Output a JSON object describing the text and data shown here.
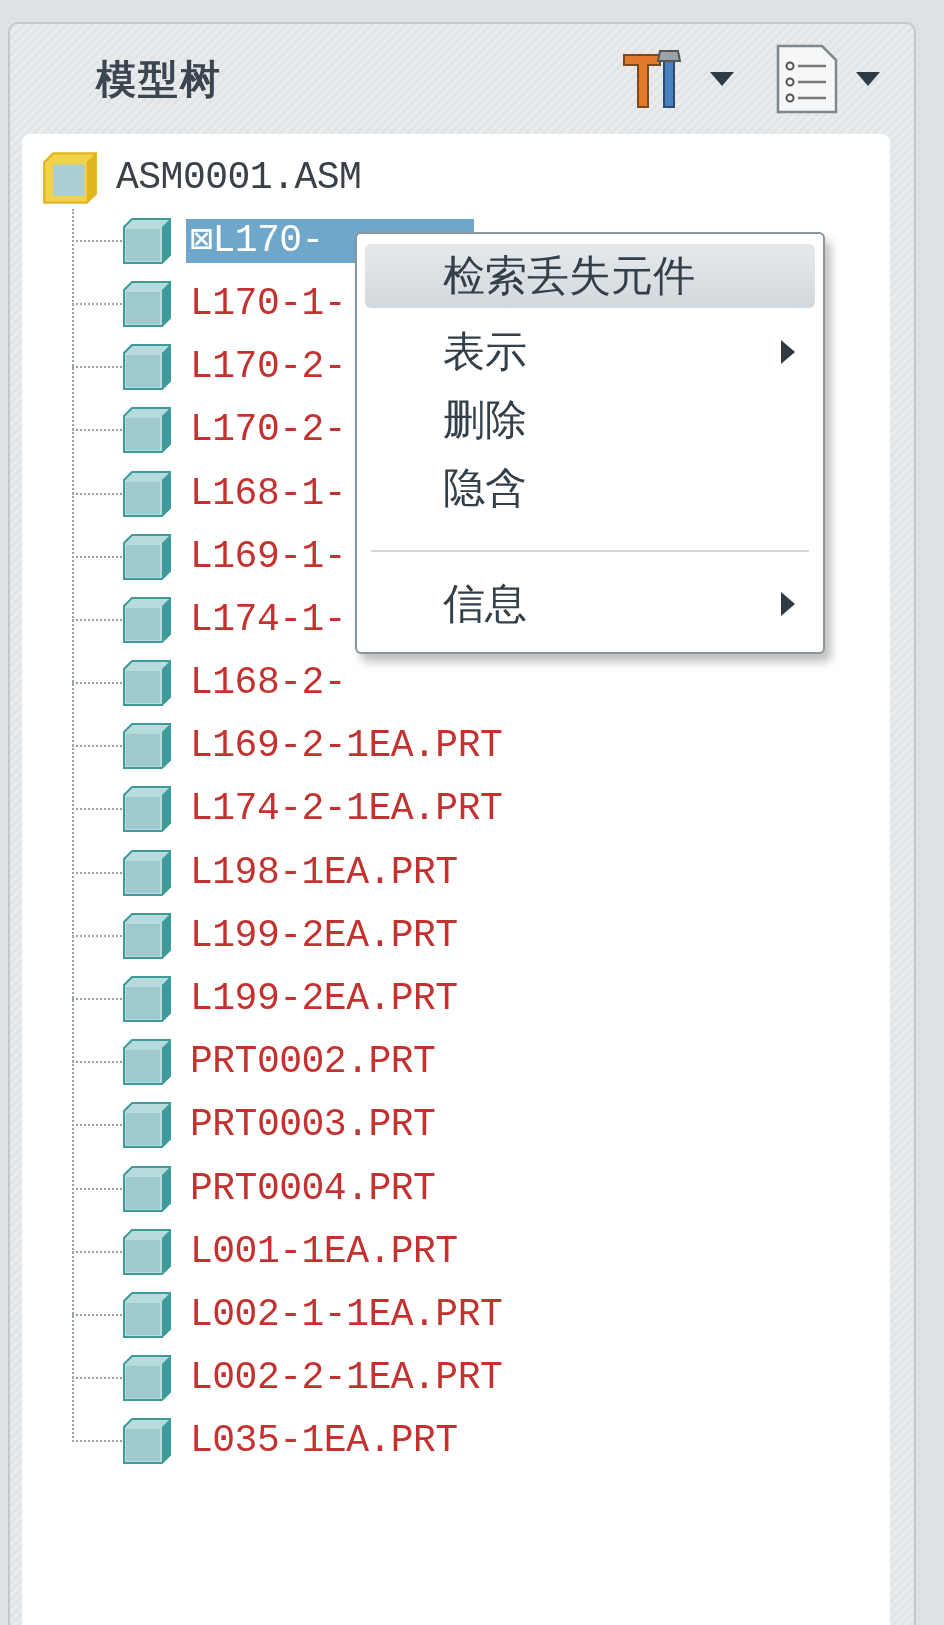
{
  "panel": {
    "title": "模型树"
  },
  "tree": {
    "label": "ASM0001.ASM",
    "kind": "assembly",
    "missing": false,
    "selected": false,
    "children": [
      {
        "label": "⊠L170-",
        "kind": "part",
        "missing": true,
        "selected": true
      },
      {
        "label": "L170-1-",
        "kind": "part",
        "missing": true,
        "selected": false
      },
      {
        "label": "L170-2-",
        "kind": "part",
        "missing": true,
        "selected": false
      },
      {
        "label": "L170-2-",
        "kind": "part",
        "missing": true,
        "selected": false
      },
      {
        "label": "L168-1-",
        "kind": "part",
        "missing": true,
        "selected": false
      },
      {
        "label": "L169-1-",
        "kind": "part",
        "missing": true,
        "selected": false
      },
      {
        "label": "L174-1-",
        "kind": "part",
        "missing": true,
        "selected": false
      },
      {
        "label": "L168-2-",
        "kind": "part",
        "missing": true,
        "selected": false
      },
      {
        "label": "L169-2-1EA.PRT",
        "kind": "part",
        "missing": true,
        "selected": false
      },
      {
        "label": "L174-2-1EA.PRT",
        "kind": "part",
        "missing": true,
        "selected": false
      },
      {
        "label": "L198-1EA.PRT",
        "kind": "part",
        "missing": true,
        "selected": false
      },
      {
        "label": "L199-2EA.PRT",
        "kind": "part",
        "missing": true,
        "selected": false
      },
      {
        "label": "L199-2EA.PRT",
        "kind": "part",
        "missing": true,
        "selected": false
      },
      {
        "label": "PRT0002.PRT",
        "kind": "part",
        "missing": true,
        "selected": false
      },
      {
        "label": "PRT0003.PRT",
        "kind": "part",
        "missing": true,
        "selected": false
      },
      {
        "label": "PRT0004.PRT",
        "kind": "part",
        "missing": true,
        "selected": false
      },
      {
        "label": "L001-1EA.PRT",
        "kind": "part",
        "missing": true,
        "selected": false
      },
      {
        "label": "L002-1-1EA.PRT",
        "kind": "part",
        "missing": true,
        "selected": false
      },
      {
        "label": "L002-2-1EA.PRT",
        "kind": "part",
        "missing": true,
        "selected": false
      },
      {
        "label": "L035-1EA.PRT",
        "kind": "part",
        "missing": true,
        "selected": false
      }
    ]
  },
  "context_menu": {
    "items": [
      {
        "kind": "item",
        "label": "检索丢失元件",
        "selected": true,
        "submenu": false
      },
      {
        "kind": "item",
        "label": "表示",
        "selected": false,
        "submenu": true
      },
      {
        "kind": "item",
        "label": "删除",
        "selected": false,
        "submenu": false
      },
      {
        "kind": "item",
        "label": "隐含",
        "selected": false,
        "submenu": false
      },
      {
        "kind": "separator"
      },
      {
        "kind": "item",
        "label": "信息",
        "selected": false,
        "submenu": true
      }
    ]
  }
}
